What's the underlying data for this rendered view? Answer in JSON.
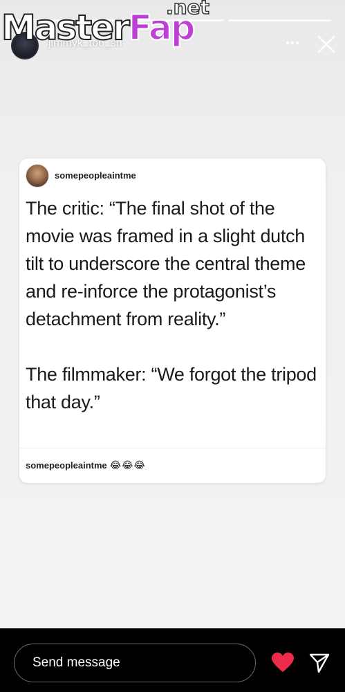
{
  "watermark": {
    "master": "Master",
    "fap": "Fap",
    "net": ".net"
  },
  "story": {
    "progress_segments": 3,
    "author": "jimmyk_too_sh",
    "menu_icon": "more-icon",
    "close_icon": "close-icon"
  },
  "post": {
    "username": "somepeopleaintme",
    "paragraphs": [
      "The critic: “The final shot of the movie was framed in a slight dutch tilt to underscore the central theme and re-inforce the protagonist’s detachment from reality.”",
      "The filmmaker: “We forgot the tripod that day.”"
    ],
    "caption_user": "somepeopleaintme",
    "caption_emojis": "😂😂😂"
  },
  "bottom": {
    "message_placeholder": "Send message",
    "heart_icon": "heart-icon",
    "send_icon": "send-icon",
    "heart_color": "#ed2b4a"
  }
}
